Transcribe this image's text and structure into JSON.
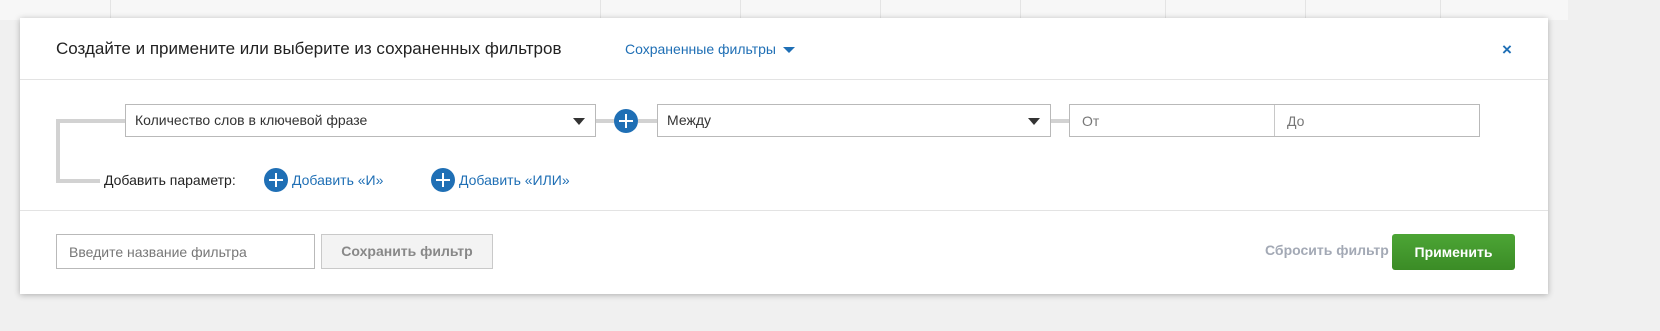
{
  "header": {
    "title": "Создайте и примените или выберите из сохраненных фильтров",
    "saved_filters_label": "Сохраненные фильтры",
    "close_label": "×"
  },
  "condition": {
    "parameter_value": "Количество слов в ключевой фразе",
    "operator_value": "Между",
    "from_placeholder": "От",
    "to_placeholder": "До"
  },
  "add_row": {
    "label": "Добавить параметр:",
    "add_and_label": "Добавить «И»",
    "add_or_label": "Добавить «ИЛИ»"
  },
  "footer": {
    "name_placeholder": "Введите название фильтра",
    "save_label": "Сохранить фильтр",
    "reset_label": "Сбросить фильтр",
    "apply_label": "Применить"
  },
  "colors": {
    "accent": "#1f6fb5",
    "apply_green": "#43982d",
    "muted_link": "#a3a9b5"
  }
}
